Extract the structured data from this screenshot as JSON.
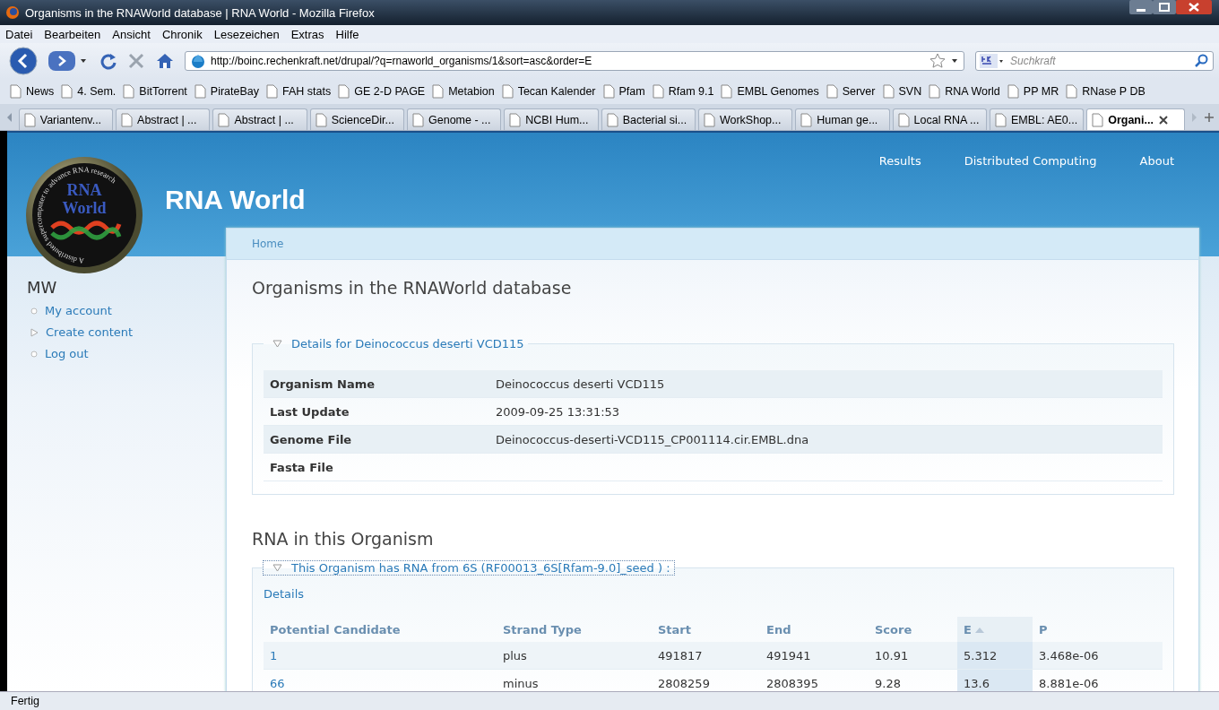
{
  "window": {
    "title": "Organisms in the RNAWorld database | RNA World - Mozilla Firefox"
  },
  "menu": [
    "Datei",
    "Bearbeiten",
    "Ansicht",
    "Chronik",
    "Lesezeichen",
    "Extras",
    "Hilfe"
  ],
  "address": {
    "url": "http://boinc.rechenkraft.net/drupal/?q=rnaworld_organisms/1&sort=asc&order=E"
  },
  "search": {
    "placeholder": "Suchkraft"
  },
  "bookmarks": [
    {
      "label": "News"
    },
    {
      "label": "4. Sem."
    },
    {
      "label": "BitTorrent"
    },
    {
      "label": "PirateBay"
    },
    {
      "label": "FAH stats"
    },
    {
      "label": "GE 2-D PAGE"
    },
    {
      "label": "Metabion"
    },
    {
      "label": "Tecan Kalender"
    },
    {
      "label": "Pfam"
    },
    {
      "label": "Rfam 9.1"
    },
    {
      "label": "EMBL Genomes"
    },
    {
      "label": "Server"
    },
    {
      "label": "SVN"
    },
    {
      "label": "RNA World"
    },
    {
      "label": "PP MR"
    },
    {
      "label": "RNase P DB"
    }
  ],
  "tabs": [
    {
      "label": "Variantenv...",
      "selected": false
    },
    {
      "label": "Abstract | ...",
      "selected": false
    },
    {
      "label": "Abstract | ...",
      "selected": false
    },
    {
      "label": "ScienceDir...",
      "selected": false
    },
    {
      "label": "Genome - ...",
      "selected": false
    },
    {
      "label": "NCBI Hum...",
      "selected": false
    },
    {
      "label": "Bacterial si...",
      "selected": false
    },
    {
      "label": "WorkShop...",
      "selected": false
    },
    {
      "label": "Human ge...",
      "selected": false
    },
    {
      "label": "Local RNA ...",
      "selected": false
    },
    {
      "label": "EMBL: AE0...",
      "selected": false
    },
    {
      "label": "Organi...",
      "selected": true
    }
  ],
  "logo": {
    "title_lines": [
      "RNA",
      "World"
    ],
    "ring_text": "A distributed supercomputer to advance RNA research"
  },
  "site": {
    "name": "RNA World",
    "nav": [
      "Results",
      "Distributed Computing",
      "About"
    ]
  },
  "sidebar": {
    "title": "MW",
    "items": [
      {
        "label": "My account",
        "kind": "leaf"
      },
      {
        "label": "Create content",
        "kind": "collapsed"
      },
      {
        "label": "Log out",
        "kind": "leaf"
      }
    ]
  },
  "breadcrumb": "Home",
  "page_title": "Organisms in the RNAWorld database",
  "details": {
    "legend": "Details for Deinococcus deserti VCD115",
    "expanded": true,
    "rows": [
      {
        "label": "Organism Name",
        "value": "Deinococcus deserti VCD115"
      },
      {
        "label": "Last Update",
        "value": "2009-09-25 13:31:53"
      },
      {
        "label": "Genome File",
        "value": "Deinococcus-deserti-VCD115_CP001114.cir.EMBL.dna"
      },
      {
        "label": "Fasta File"
      }
    ]
  },
  "rna": {
    "heading": "RNA in this Organism",
    "legend": "This Organism has RNA from 6S (RF00013_6S[Rfam-9.0]_seed ) :",
    "expanded": true,
    "link": "Details",
    "table": {
      "columns": [
        {
          "label": "Potential Candidate",
          "sorted": false
        },
        {
          "label": "Strand Type",
          "sorted": false
        },
        {
          "label": "Start",
          "sorted": false
        },
        {
          "label": "End",
          "sorted": false
        },
        {
          "label": "Score",
          "sorted": false
        },
        {
          "label": "E",
          "sorted": true
        },
        {
          "label": "P",
          "sorted": false
        }
      ],
      "rows": [
        [
          "1",
          "plus",
          "491817",
          "491941",
          "10.91",
          "5.312",
          "3.468e-06"
        ],
        [
          "66",
          "minus",
          "2808259",
          "2808395",
          "9.28",
          "13.6",
          "8.881e-06"
        ]
      ]
    }
  },
  "status_bar": "Fertig"
}
